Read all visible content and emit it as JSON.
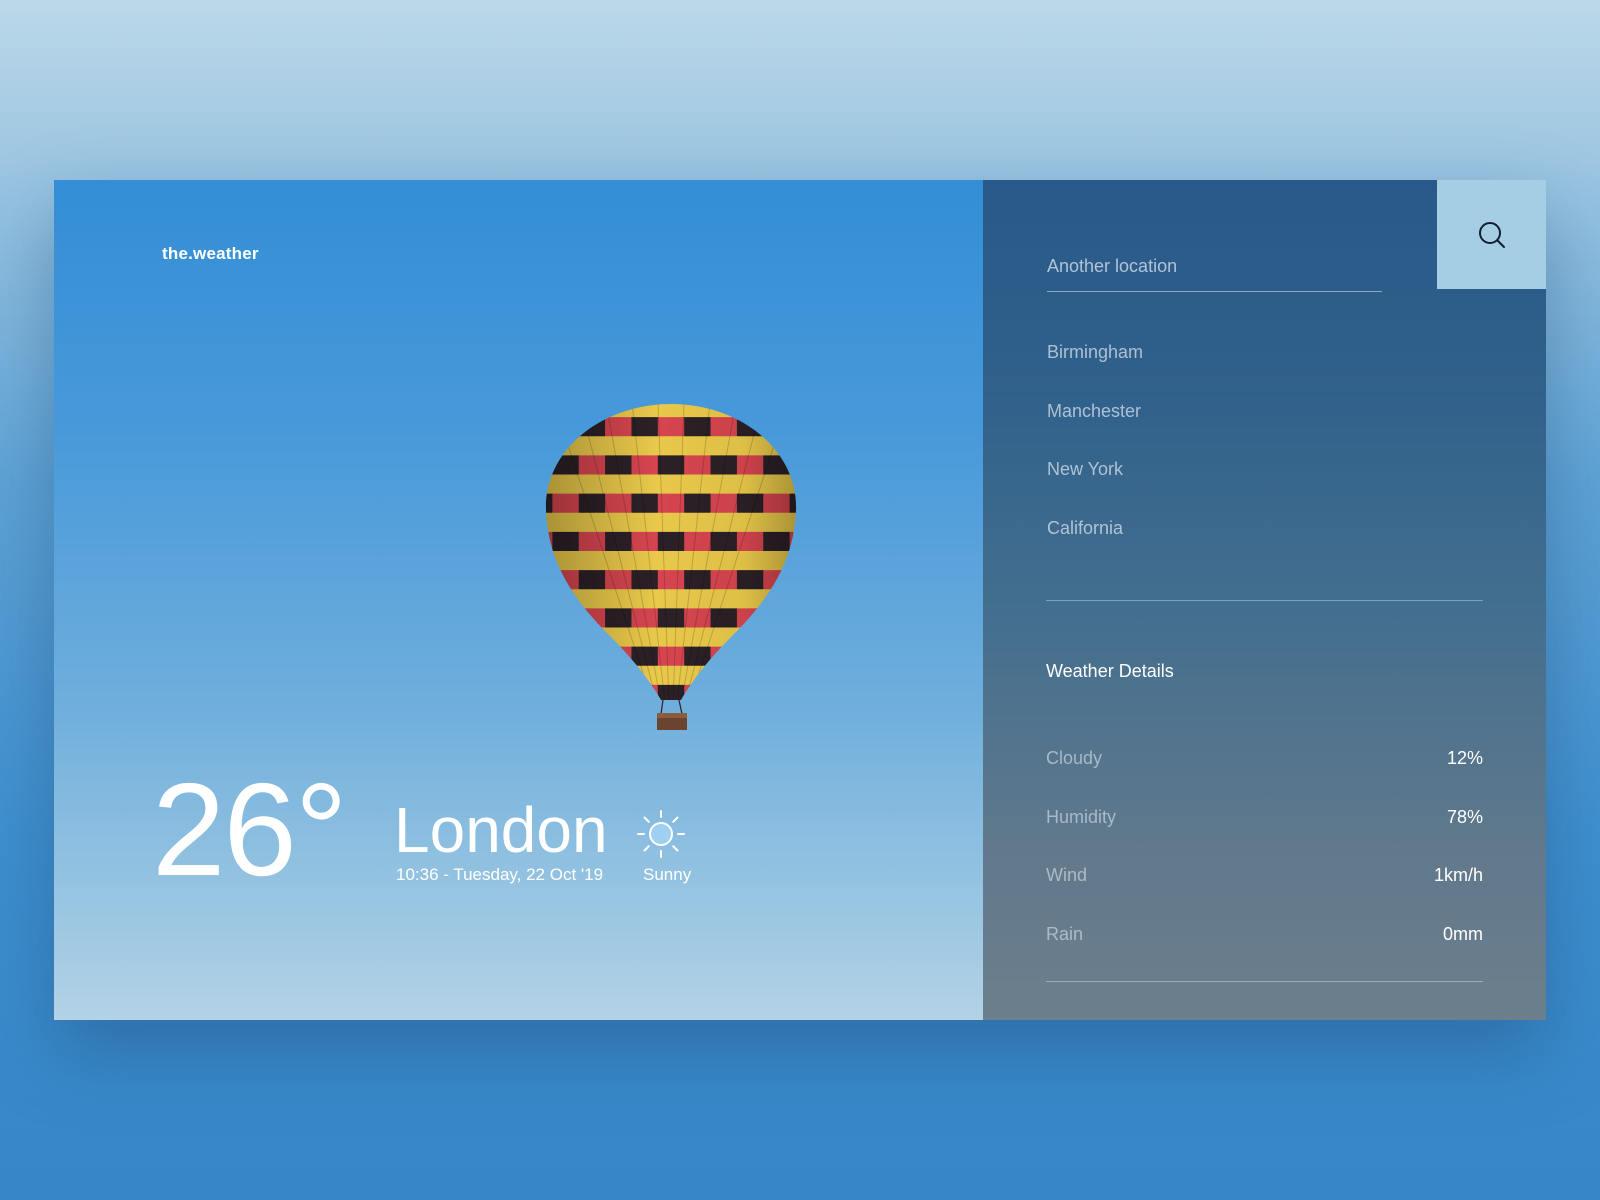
{
  "brand": "the.weather",
  "current": {
    "temperature": "26°",
    "city": "London",
    "datetime": "10:36 - Tuesday, 22 Oct '19",
    "condition": "Sunny",
    "condition_icon": "sun-icon"
  },
  "search": {
    "placeholder": "Another location",
    "button_icon": "search-icon"
  },
  "locations": [
    "Birmingham",
    "Manchester",
    "New York",
    "California"
  ],
  "details": {
    "title": "Weather Details",
    "rows": [
      {
        "label": "Cloudy",
        "value": "12%"
      },
      {
        "label": "Humidity",
        "value": "78%"
      },
      {
        "label": "Wind",
        "value": "1km/h"
      },
      {
        "label": "Rain",
        "value": "0mm"
      }
    ]
  },
  "colors": {
    "sky_top": "#338ed5",
    "sky_bottom": "#b3d2e6",
    "sidebar_top": "#28598a",
    "sidebar_bottom": "#6c7f8c",
    "search_button": "#a5cde3",
    "sun_fill": "#9fd0f2",
    "balloon_yellow": "#e9c94a",
    "balloon_red": "#d6454f",
    "balloon_dark": "#2b2026"
  }
}
